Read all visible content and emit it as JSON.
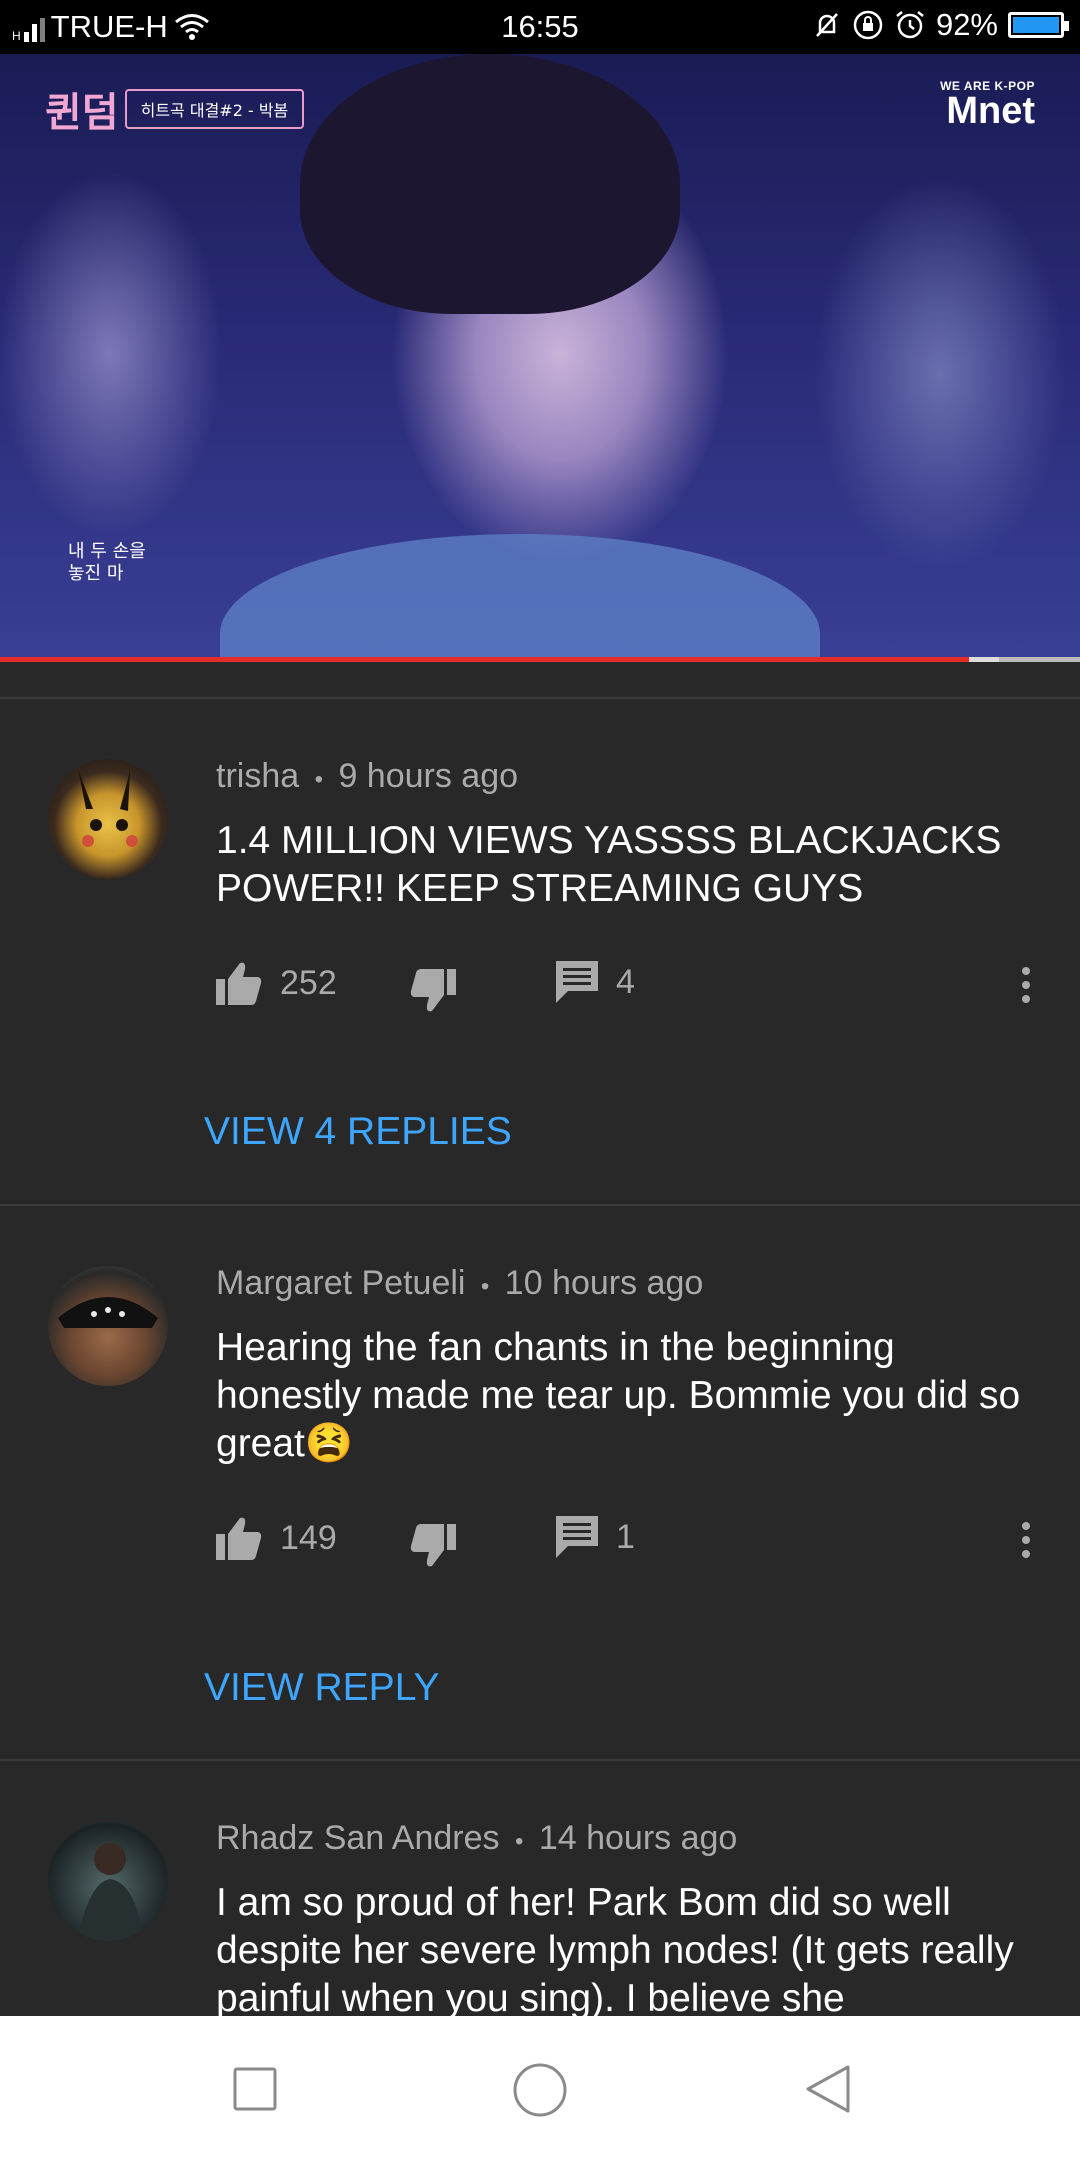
{
  "status_bar": {
    "carrier": "TRUE-H",
    "time": "16:55",
    "battery": "92%"
  },
  "video": {
    "show_logo": "퀸덤",
    "segment_tag": "히트곡 대결#2 - 박봄",
    "network_tagline": "WE ARE K-POP",
    "network_name": "Mnet",
    "subtitle_line1": "내 두 손을",
    "subtitle_line2": "놓진 마",
    "progress_fraction": 0.897
  },
  "comments": [
    {
      "author": "trisha",
      "time": "9 hours ago",
      "text": "1.4 MILLION VIEWS YASSSS BLACKJACKS POWER!! KEEP STREAMING GUYS",
      "likes": "252",
      "replies_count": "4",
      "view_replies": "VIEW 4 REPLIES"
    },
    {
      "author": "Margaret Petueli",
      "time": "10 hours ago",
      "text": "Hearing the fan chants in the beginning honestly made me tear up. Bommie you did so great😫",
      "likes": "149",
      "replies_count": "1",
      "view_replies": "VIEW REPLY"
    },
    {
      "author": "Rhadz San Andres",
      "time": "14 hours ago",
      "text": "I am so proud of her! Park Bom did so well despite her severe lymph nodes! (It gets really painful when you sing). I believe she"
    }
  ],
  "separator": "•",
  "colors": {
    "background": "#282828",
    "link": "#3ea6ff",
    "progress": "#e52d27"
  }
}
